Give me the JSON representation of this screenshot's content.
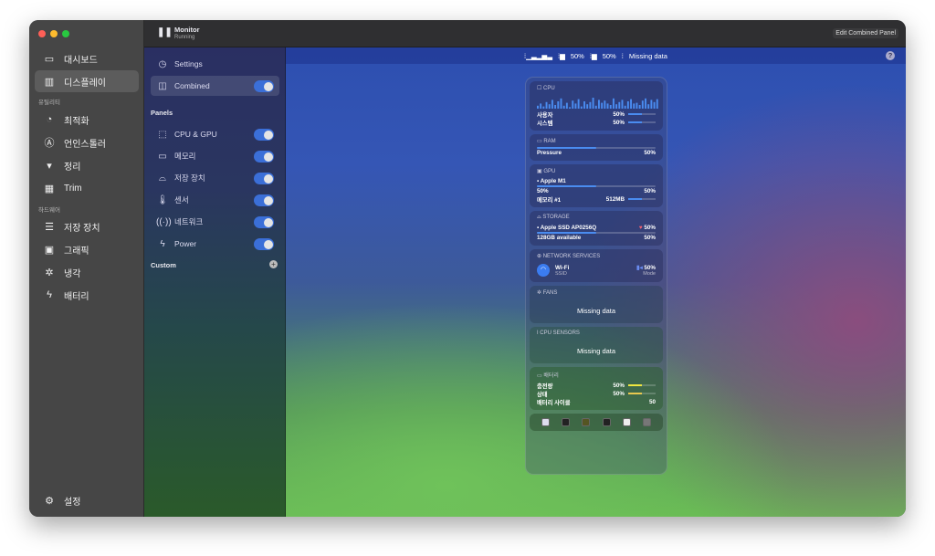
{
  "colors": {
    "accent": "#3b6fd8",
    "bar": "#4a8cf0",
    "battery_bar": "#e8d84a"
  },
  "sidebar": {
    "items": [
      {
        "label": "대시보드",
        "icon": "laptop-icon"
      },
      {
        "label": "디스플레이",
        "icon": "chart-icon",
        "selected": true
      }
    ],
    "section_utility": "유틸리티",
    "utility": [
      {
        "label": "최적화",
        "icon": "gauge-icon"
      },
      {
        "label": "언인스톨러",
        "icon": "app-store-icon"
      },
      {
        "label": "정리",
        "icon": "bin-icon"
      },
      {
        "label": "Trim",
        "icon": "grid-icon"
      }
    ],
    "section_hardware": "하드웨어",
    "hardware": [
      {
        "label": "저장 장치",
        "icon": "storage-icon"
      },
      {
        "label": "그래픽",
        "icon": "gpu-icon"
      },
      {
        "label": "냉각",
        "icon": "fan-icon"
      },
      {
        "label": "배터리",
        "icon": "battery-icon"
      }
    ],
    "settings": "설정"
  },
  "header": {
    "title": "Monitor",
    "status": "Running",
    "edit_button": "Edit Combined Panel"
  },
  "panel_list": {
    "settings": "Settings",
    "combined": "Combined",
    "combined_on": true,
    "panels_heading": "Panels",
    "panels": [
      {
        "label": "CPU & GPU",
        "on": true
      },
      {
        "label": "메모리",
        "on": true
      },
      {
        "label": "저장 장치",
        "on": true
      },
      {
        "label": "센서",
        "on": true
      },
      {
        "label": "네트워크",
        "on": true
      },
      {
        "label": "Power",
        "on": true
      }
    ],
    "custom_heading": "Custom"
  },
  "menubar_preview": {
    "cpu_value": "50%",
    "ram_value": "50%",
    "missing": "Missing data",
    "help": "?"
  },
  "widget": {
    "cpu": {
      "title": "CPU",
      "user_label": "사용자",
      "user_value": "50%",
      "user_pct": 50,
      "system_label": "시스템",
      "system_value": "50%",
      "system_pct": 50,
      "history": [
        20,
        35,
        15,
        45,
        30,
        60,
        25,
        50,
        70,
        20,
        40,
        10,
        55,
        35,
        65,
        15,
        50,
        30,
        45,
        75,
        20,
        60,
        40,
        55,
        35,
        25,
        70,
        30,
        45,
        60,
        20,
        50,
        65,
        35,
        40,
        25,
        55,
        70,
        30,
        60,
        45,
        65
      ]
    },
    "ram": {
      "title": "RAM",
      "pressure_label": "Pressure",
      "pressure_value": "50%",
      "pct": 50
    },
    "gpu": {
      "title": "GPU",
      "name": "Apple M1",
      "pct": 50,
      "left_value": "50%",
      "right_value": "50%",
      "memory_label": "메모리 #1",
      "memory_value": "512MB"
    },
    "storage": {
      "title": "STORAGE",
      "name": "Apple SSD AP0256Q",
      "health": "50%",
      "pct": 50,
      "available": "128GB available",
      "available_value": "50%"
    },
    "network": {
      "title": "NETWORK SERVICES",
      "name": "Wi-Fi",
      "sub": "SSID",
      "value": "50%",
      "mode": "Mode"
    },
    "fans": {
      "title": "FANS",
      "missing": "Missing data"
    },
    "sensors": {
      "title": "CPU SENSORS",
      "missing": "Missing data"
    },
    "battery": {
      "title": "배터리",
      "charge_label": "충전량",
      "charge_value": "50%",
      "charge_pct": 50,
      "state_label": "상태",
      "state_value": "50%",
      "state_pct": 50,
      "cycles_label": "배터리 사이클",
      "cycles_value": "50"
    }
  }
}
